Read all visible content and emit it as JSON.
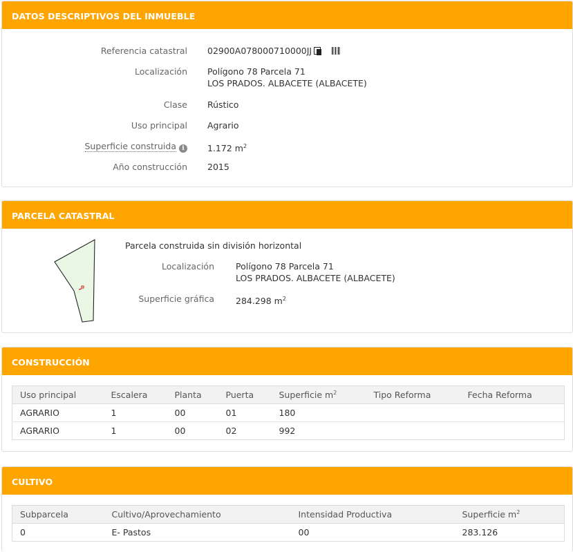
{
  "inmueble": {
    "header": "DATOS DESCRIPTIVOS DEL INMUEBLE",
    "ref_label": "Referencia catastral",
    "ref_value": "02900A078000710000JJ",
    "loc_label": "Localización",
    "loc_line1": "Polígono 78 Parcela 71",
    "loc_line2": "LOS PRADOS. ALBACETE (ALBACETE)",
    "clase_label": "Clase",
    "clase_value": "Rústico",
    "uso_label": "Uso principal",
    "uso_value": "Agrario",
    "sup_label": "Superficie construida",
    "sup_value": "1.172 m",
    "sup_unit_sup": "2",
    "anio_label": "Año construcción",
    "anio_value": "2015"
  },
  "parcela": {
    "header": "PARCELA CATASTRAL",
    "title": "Parcela construida sin división horizontal",
    "loc_label": "Localización",
    "loc_line1": "Polígono 78 Parcela 71",
    "loc_line2": "LOS PRADOS. ALBACETE (ALBACETE)",
    "sup_label": "Superficie gráfica",
    "sup_value": "284.298 m",
    "sup_unit_sup": "2"
  },
  "construccion": {
    "header": "CONSTRUCCIÓN",
    "columns": [
      "Uso principal",
      "Escalera",
      "Planta",
      "Puerta",
      "Superficie m",
      "Tipo Reforma",
      "Fecha Reforma"
    ],
    "sup_col_sup": "2",
    "rows": [
      [
        "AGRARIO",
        "1",
        "00",
        "01",
        "180",
        "",
        ""
      ],
      [
        "AGRARIO",
        "1",
        "00",
        "02",
        "992",
        "",
        ""
      ]
    ]
  },
  "cultivo": {
    "header": "CULTIVO",
    "columns": [
      "Subparcela",
      "Cultivo/Aprovechamiento",
      "Intensidad Productiva",
      "Superficie m"
    ],
    "sup_col_sup": "2",
    "rows": [
      [
        "0",
        "E- Pastos",
        "00",
        "283.126"
      ]
    ]
  },
  "colors": {
    "header_bg": "#ffa500",
    "parcel_fill": "#e9f7e4"
  },
  "icons": [
    "copy-icon",
    "barcode-icon",
    "info-icon"
  ]
}
